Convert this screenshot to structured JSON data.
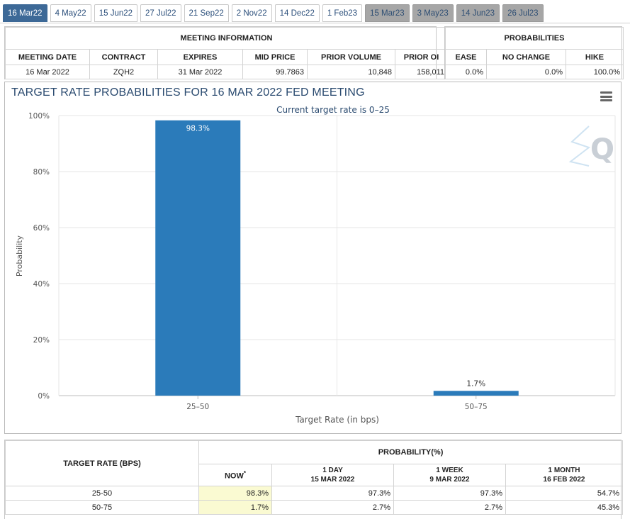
{
  "tabs": [
    {
      "label": "16 Mar22",
      "state": "active"
    },
    {
      "label": "4 May22",
      "state": "normal"
    },
    {
      "label": "15 Jun22",
      "state": "normal"
    },
    {
      "label": "27 Jul22",
      "state": "normal"
    },
    {
      "label": "21 Sep22",
      "state": "normal"
    },
    {
      "label": "2 Nov22",
      "state": "normal"
    },
    {
      "label": "14 Dec22",
      "state": "normal"
    },
    {
      "label": "1 Feb23",
      "state": "normal"
    },
    {
      "label": "15 Mar23",
      "state": "future"
    },
    {
      "label": "3 May23",
      "state": "future"
    },
    {
      "label": "14 Jun23",
      "state": "future"
    },
    {
      "label": "26 Jul23",
      "state": "future"
    }
  ],
  "meeting_info": {
    "title": "MEETING INFORMATION",
    "headers": [
      "MEETING DATE",
      "CONTRACT",
      "EXPIRES",
      "MID PRICE",
      "PRIOR VOLUME",
      "PRIOR OI"
    ],
    "row": [
      "16 Mar 2022",
      "ZQH2",
      "31 Mar 2022",
      "99.7863",
      "10,848",
      "158,011"
    ]
  },
  "probabilities": {
    "title": "PROBABILITIES",
    "headers": [
      "EASE",
      "NO CHANGE",
      "HIKE"
    ],
    "row": [
      "0.0%",
      "0.0%",
      "100.0%"
    ]
  },
  "chart": {
    "title": "TARGET RATE PROBABILITIES FOR 16 MAR 2022 FED MEETING",
    "subtitle": "Current target rate is 0–25",
    "menu_icon": "hamburger-menu-icon",
    "watermark_icon": "cme-q-logo-icon"
  },
  "chart_data": {
    "type": "bar",
    "title": "TARGET RATE PROBABILITIES FOR 16 MAR 2022 FED MEETING",
    "subtitle": "Current target rate is 0–25",
    "categories": [
      "25–50",
      "50–75"
    ],
    "values": [
      98.3,
      1.7
    ],
    "data_labels": [
      "98.3%",
      "1.7%"
    ],
    "xlabel": "Target Rate (in bps)",
    "ylabel": "Probability",
    "ylim": [
      0,
      100
    ],
    "yticks": [
      "0%",
      "20%",
      "40%",
      "60%",
      "80%",
      "100%"
    ],
    "grid": true,
    "bar_color": "#2b7bba"
  },
  "bottom_table": {
    "left_header": "TARGET RATE (BPS)",
    "group_header": "PROBABILITY(%)",
    "columns": [
      {
        "line1": "NOW",
        "line2": "",
        "marker": "*"
      },
      {
        "line1": "1 DAY",
        "line2": "15 MAR 2022",
        "marker": ""
      },
      {
        "line1": "1 WEEK",
        "line2": "9 MAR 2022",
        "marker": ""
      },
      {
        "line1": "1 MONTH",
        "line2": "16 FEB 2022",
        "marker": ""
      }
    ],
    "rows": [
      {
        "rate": "25-50",
        "values": [
          "98.3%",
          "97.3%",
          "97.3%",
          "54.7%"
        ]
      },
      {
        "rate": "50-75",
        "values": [
          "1.7%",
          "2.7%",
          "2.7%",
          "45.3%"
        ]
      }
    ]
  }
}
